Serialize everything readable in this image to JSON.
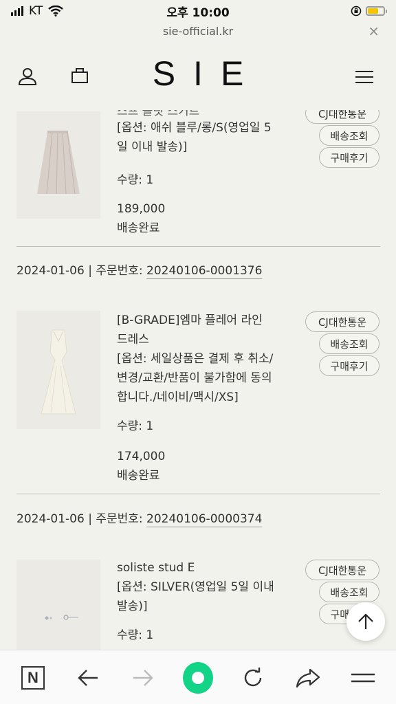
{
  "status_bar": {
    "carrier": "KT",
    "time": "오후 10:00"
  },
  "browser": {
    "url": "sie-official.kr",
    "close_label": "×"
  },
  "site": {
    "logo": "SIE"
  },
  "orders": {
    "item1": {
      "title_partial": "스프 플릿 스커트",
      "option": "[옵션: 애쉬 블루/롱/S(영업일 5일 이내 발송)]",
      "option_line1": "[옵션: 애쉬 블루/롱/S(영업일 5",
      "option_line2": "일 이내 발송)]",
      "qty": "수량: 1",
      "price": "189,000",
      "status": "배송완료",
      "courier": "CJ대한통운",
      "track": "배송조회",
      "review": "구매후기"
    },
    "order2": {
      "date": "2024-01-06",
      "sep": " | 주문번호: ",
      "number": "20240106-0001376"
    },
    "item2": {
      "title_line1": "[B-GRADE]엠마 플레어 라인",
      "title_line2": "드레스",
      "option_line1": "[옵션: 세일상품은 결제 후 취소/",
      "option_line2": "변경/교환/반품이 불가함에 동의",
      "option_line3": "합니다./네이비/맥시/XS]",
      "qty": "수량: 1",
      "price": "174,000",
      "status": "배송완료",
      "courier": "CJ대한통운",
      "track": "배송조회",
      "review": "구매후기"
    },
    "order3": {
      "date": "2024-01-06",
      "sep": " | 주문번호: ",
      "number": "20240106-0000374"
    },
    "item3": {
      "title": "soliste stud E",
      "option_line1": "[옵션: SILVER(영업일 5일 이내",
      "option_line2": "발송)]",
      "qty": "수량: 1",
      "courier": "CJ대한통운",
      "track": "배송조회",
      "review": "구매후기"
    }
  },
  "colors": {
    "background": "#f2f2ed",
    "accent_green": "#12d386",
    "battery": "#f5c400"
  }
}
